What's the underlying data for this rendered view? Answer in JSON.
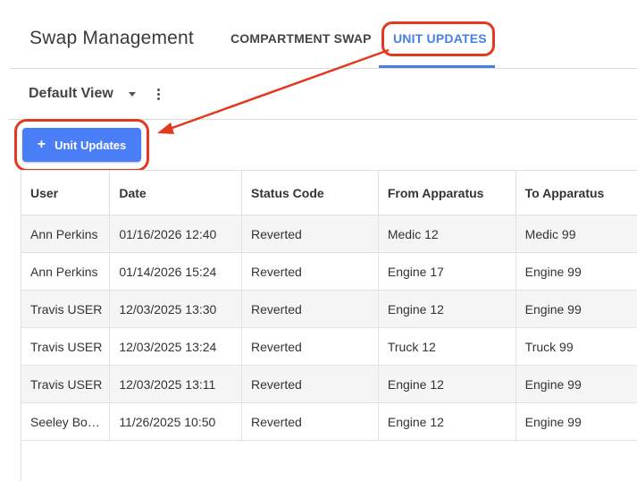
{
  "header": {
    "app_title": "Swap Management",
    "tabs": [
      {
        "label": "COMPARTMENT SWAP",
        "active": false
      },
      {
        "label": "UNIT UPDATES",
        "active": true
      }
    ]
  },
  "view": {
    "selected": "Default View"
  },
  "actions": {
    "add_label": "Unit Updates"
  },
  "colors": {
    "accent": "#4a7ef6",
    "callout": "#e2391f"
  },
  "table": {
    "columns": [
      "User",
      "Date",
      "Status Code",
      "From Apparatus",
      "To Apparatus"
    ],
    "rows": [
      [
        "Ann Perkins",
        "01/16/2026 12:40",
        "Reverted",
        "Medic 12",
        "Medic 99"
      ],
      [
        "Ann Perkins",
        "01/14/2026 15:24",
        "Reverted",
        "Engine 17",
        "Engine 99"
      ],
      [
        "Travis USER",
        "12/03/2025 13:30",
        "Reverted",
        "Engine 12",
        "Engine 99"
      ],
      [
        "Travis USER",
        "12/03/2025 13:24",
        "Reverted",
        "Truck 12",
        "Truck 99"
      ],
      [
        "Travis USER",
        "12/03/2025 13:11",
        "Reverted",
        "Engine 12",
        "Engine 99"
      ],
      [
        "Seeley Bo…",
        "11/26/2025 10:50",
        "Reverted",
        "Engine 12",
        "Engine 99"
      ]
    ]
  }
}
